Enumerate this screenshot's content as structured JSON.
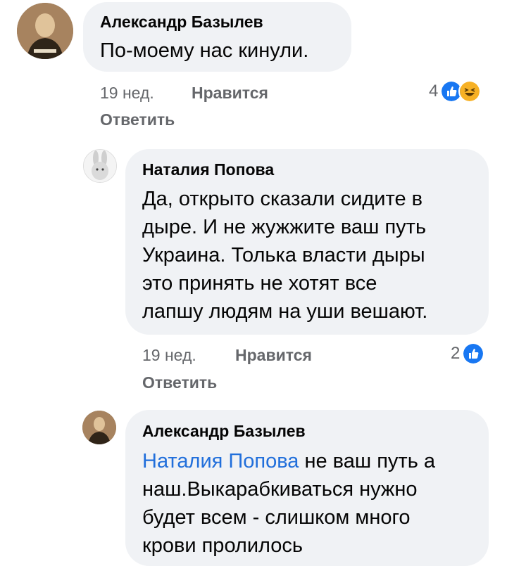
{
  "comments": [
    {
      "author": "Александр Базылев",
      "lines": [
        "По-моему нас кинули."
      ],
      "time": "19 нед.",
      "like_label": "Нравится",
      "reply_label": "Ответить",
      "reaction_count": "4",
      "reactions": [
        "like-icon",
        "haha-icon"
      ]
    },
    {
      "author": "Наталия Попова",
      "lines": [
        "Да, открыто сказали сидите в",
        "дыре. И не жужжите ваш путь",
        "Украина. Толька власти дыры",
        "это принять не хотят все",
        "лапшу людям на уши вешают."
      ],
      "time": "19 нед.",
      "like_label": "Нравится",
      "reply_label": "Ответить",
      "reaction_count": "2",
      "reactions": [
        "like-icon"
      ]
    },
    {
      "author": "Александр Базылев",
      "mention": "Наталия Попова",
      "first_line_rest": " не ваш путь а",
      "lines": [
        "наш.Выкарабкиваться нужно",
        "будет всем - слишком много",
        "крови пролилось"
      ]
    }
  ],
  "colors": {
    "bubble": "#f0f2f5",
    "meta_text": "#65676b",
    "mention": "#216fdb",
    "like_blue": "#1877f2",
    "haha_yellow": "#f7b125"
  }
}
